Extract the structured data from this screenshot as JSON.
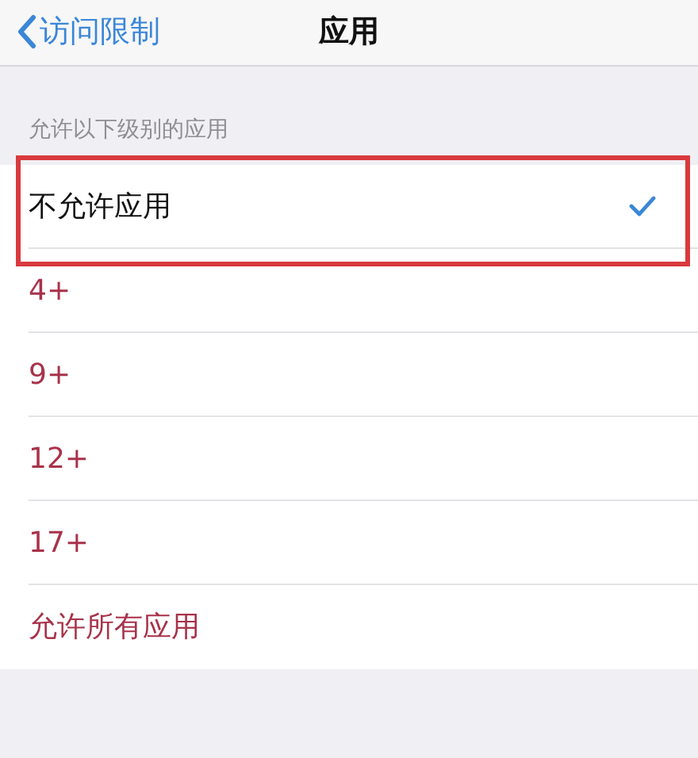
{
  "nav_bar": {
    "back_label": "访问限制",
    "title": "应用"
  },
  "section": {
    "header": "允许以下级别的应用",
    "options": [
      {
        "label": "不允许应用",
        "selected": true,
        "disabled": false,
        "highlighted": true
      },
      {
        "label": "4+",
        "selected": false,
        "disabled": true,
        "highlighted": false
      },
      {
        "label": "9+",
        "selected": false,
        "disabled": true,
        "highlighted": false
      },
      {
        "label": "12+",
        "selected": false,
        "disabled": true,
        "highlighted": false
      },
      {
        "label": "17+",
        "selected": false,
        "disabled": true,
        "highlighted": false
      },
      {
        "label": "允许所有应用",
        "selected": false,
        "disabled": true,
        "highlighted": false
      }
    ]
  }
}
